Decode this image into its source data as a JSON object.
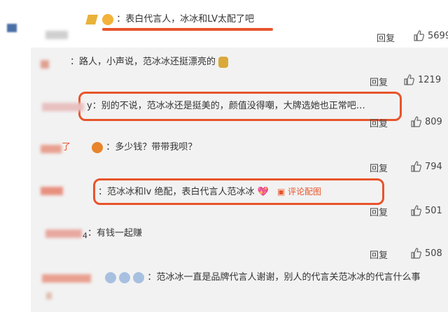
{
  "comments": [
    {
      "prefix": "：",
      "text": "表白代言人，冰冰和LV太配了吧",
      "reply": "回复",
      "likes": "5699"
    },
    {
      "prefix": "：",
      "text": "路人，小声说，范冰冰还挺漂亮的",
      "reply": "回复",
      "likes": "1219"
    },
    {
      "prefix": "y：",
      "text": "别的不说，范冰冰还是挺美的，颜值没得嘲，大牌选她也正常吧…",
      "reply": "回复",
      "likes": "809"
    },
    {
      "prefix": "了",
      "sep": "：",
      "text": "多少钱？带带我呗？",
      "reply": "回复",
      "likes": "794"
    },
    {
      "prefix": "：",
      "text": "范冰冰和lv 绝配，表白代言人范冰冰",
      "pic_label": "评论配图",
      "reply": "回复",
      "likes": "501"
    },
    {
      "prefix": "4",
      "sep": "：",
      "text": "有钱一起赚",
      "reply": "回复",
      "likes": "508"
    },
    {
      "prefix": "：",
      "text": "范冰冰一直是品牌代言人谢谢，别人的代言关范冰冰的代言什么事"
    }
  ],
  "colors": {
    "highlight": "#e8542b",
    "reply_bg": "#f2f2f2",
    "text": "#333333"
  },
  "icons": {
    "like": "thumbs-up-icon",
    "pic": "image-icon",
    "emoji": "emoji-face-icon"
  }
}
